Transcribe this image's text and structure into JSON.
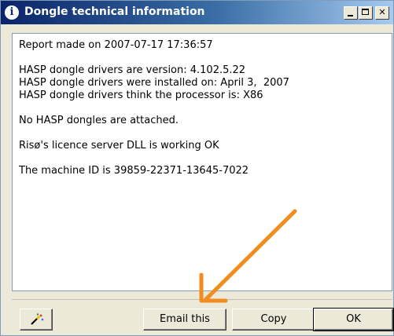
{
  "window": {
    "title": "Dongle technical information",
    "title_icon": "i",
    "controls": [
      "minimize",
      "maximize",
      "close"
    ]
  },
  "report": {
    "lines": [
      "Report made on 2007-07-17 17:36:57",
      "",
      "HASP dongle drivers are version: 4.102.5.22",
      "HASP dongle drivers were installed on: April 3,  2007",
      "HASP dongle drivers think the processor is: X86",
      "",
      "No HASP dongles are attached.",
      "",
      "Risø's licence server DLL is working OK",
      "",
      "The machine ID is 39859-22371-13645-7022"
    ]
  },
  "buttons": {
    "tool_icon": "magic-wand-icon",
    "email": "Email this",
    "copy": "Copy",
    "ok": "OK"
  },
  "annotation": {
    "arrow_color": "#f28c1e",
    "arrow_points_to": "email-button"
  },
  "colors": {
    "titlebar_start": "#0a246a",
    "titlebar_end": "#a6caf0",
    "window_bg": "#ece9d8"
  }
}
